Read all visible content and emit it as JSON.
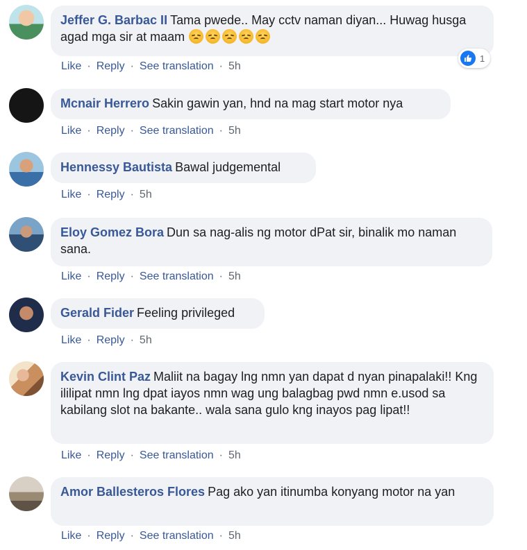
{
  "comments": [
    {
      "author": "Jeffer G. Barbac II",
      "text": "Tama pwede.. May cctv naman diyan... Huwag husga agad mga sir at maam",
      "emoji_count": 5,
      "actions": {
        "like": "Like",
        "reply": "Reply",
        "translate": "See translation",
        "time": "5h"
      },
      "reaction_count": "1"
    },
    {
      "author": "Mcnair Herrero",
      "text": "Sakin gawin yan, hnd na mag start motor nya",
      "actions": {
        "like": "Like",
        "reply": "Reply",
        "translate": "See translation",
        "time": "5h"
      }
    },
    {
      "author": "Hennessy Bautista",
      "text": "Bawal judgemental",
      "actions": {
        "like": "Like",
        "reply": "Reply",
        "time": "5h"
      }
    },
    {
      "author": "Eloy Gomez Bora",
      "text": "Dun sa nag-alis ng motor dPat sir, binalik mo naman sana.",
      "actions": {
        "like": "Like",
        "reply": "Reply",
        "translate": "See translation",
        "time": "5h"
      }
    },
    {
      "author": "Gerald Fider",
      "text": "Feeling privileged",
      "actions": {
        "like": "Like",
        "reply": "Reply",
        "time": "5h"
      }
    },
    {
      "author": "Kevin Clint Paz",
      "text": "Maliit na bagay lng nmn yan dapat d nyan pinapalaki!! Kng ililipat nmn lng dpat iayos nmn wag ung balagbag pwd nmn e.usod sa kabilang slot na bakante.. wala sana gulo kng inayos pag lipat!!",
      "actions": {
        "like": "Like",
        "reply": "Reply",
        "translate": "See translation",
        "time": "5h"
      }
    },
    {
      "author": "Amor Ballesteros Flores",
      "text": "Pag ako yan itinumba konyang motor na yan",
      "actions": {
        "like": "Like",
        "reply": "Reply",
        "translate": "See translation",
        "time": "5h"
      }
    }
  ],
  "colors": {
    "link": "#385898",
    "bubble": "#f0f2f5",
    "meta": "#606770",
    "like_blue": "#1877f2"
  }
}
